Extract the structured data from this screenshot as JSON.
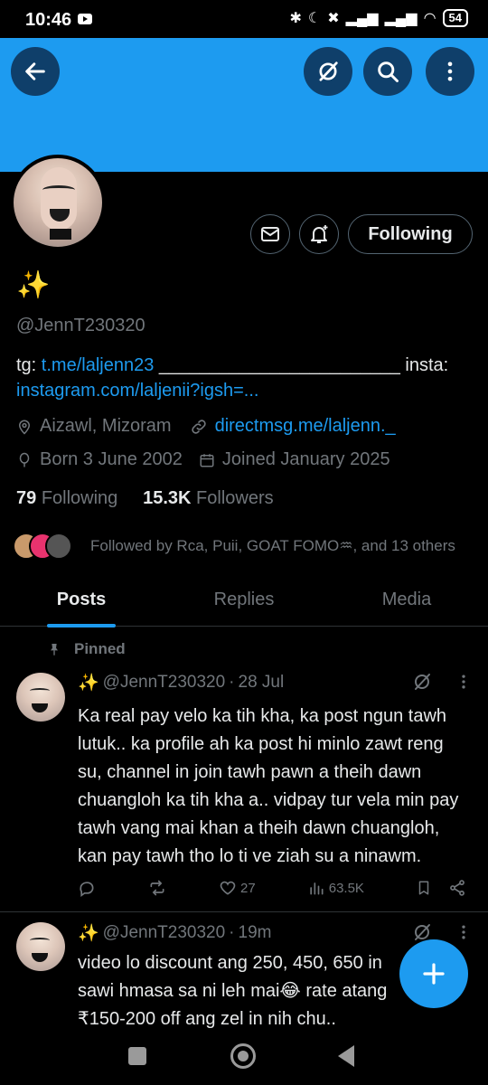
{
  "status": {
    "time": "10:46",
    "battery": "54"
  },
  "profile": {
    "name_emoji": "✨",
    "handle": "@JennT230320",
    "bio_prefix": "tg: ",
    "bio_tg_link": "t.me/laljenn23",
    "bio_middle": " ________________________ insta:",
    "bio_insta_link": "instagram.com/laljenii?igsh=...",
    "location": "Aizawl, Mizoram",
    "website": "directmsg.me/laljenn._",
    "born": "Born 3 June 2002",
    "joined": "Joined January 2025",
    "following_count": "79",
    "following_label": "Following",
    "followers_count": "15.3K",
    "followers_label": "Followers",
    "followed_by": "Followed by Rca, Puii, GOAT FOMO♒, and 13 others",
    "follow_button": "Following"
  },
  "tabs": [
    "Posts",
    "Replies",
    "Media"
  ],
  "pinned_label": "Pinned",
  "tweets": [
    {
      "emoji": "✨",
      "handle": "@JennT230320",
      "sep": "·",
      "time": "28 Jul",
      "text": "Ka real pay velo ka tih kha, ka post ngun tawh lutuk.. ka profile ah ka post hi minlo zawt reng su, channel in join tawh pawn a theih dawn chuangloh ka tih kha a.. vidpay tur vela min pay tawh vang mai khan a theih dawn chuangloh, kan pay tawh tho lo ti ve ziah su a ninawm.",
      "likes": "27",
      "views": "63.5K"
    },
    {
      "emoji": "✨",
      "handle": "@JennT230320",
      "sep": "·",
      "time": "19m",
      "text": "video lo discount ang 250, 450, 650 in sawi hmasa sa ni leh mai😂 rate atang ₹150-200 off ang zel in nih chu.."
    }
  ],
  "colors": {
    "accent": "#1d9bf0",
    "banner": "#1d9bf0",
    "muted": "#71767b"
  }
}
